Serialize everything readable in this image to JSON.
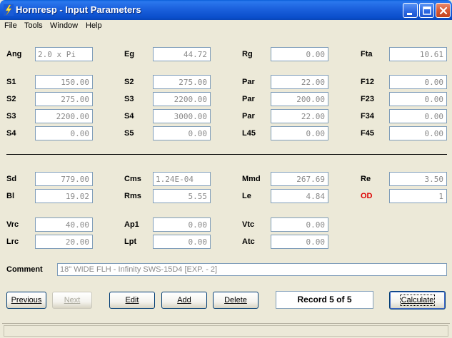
{
  "window": {
    "title": "Hornresp - Input Parameters"
  },
  "menu": {
    "items": [
      "File",
      "Tools",
      "Window",
      "Help"
    ]
  },
  "rows": [
    {
      "top": "row1",
      "cells": [
        {
          "label": "Ang",
          "value": "2.0 x Pi",
          "align": "left"
        },
        {
          "label": "Eg",
          "value": "44.72"
        },
        {
          "label": "Rg",
          "value": "0.00"
        },
        {
          "label": "Fta",
          "value": "10.61"
        }
      ]
    },
    {
      "cells": [
        {
          "label": "S1",
          "value": "150.00"
        },
        {
          "label": "S2",
          "value": "275.00"
        },
        {
          "label": "Par",
          "value": "22.00"
        },
        {
          "label": "F12",
          "value": "0.00"
        }
      ]
    },
    {
      "cells": [
        {
          "label": "S2",
          "value": "275.00"
        },
        {
          "label": "S3",
          "value": "2200.00"
        },
        {
          "label": "Par",
          "value": "200.00"
        },
        {
          "label": "F23",
          "value": "0.00"
        }
      ]
    },
    {
      "cells": [
        {
          "label": "S3",
          "value": "2200.00"
        },
        {
          "label": "S4",
          "value": "3000.00"
        },
        {
          "label": "Par",
          "value": "22.00"
        },
        {
          "label": "F34",
          "value": "0.00"
        }
      ]
    },
    {
      "cells": [
        {
          "label": "S4",
          "value": "0.00"
        },
        {
          "label": "S5",
          "value": "0.00"
        },
        {
          "label": "L45",
          "value": "0.00"
        },
        {
          "label": "F45",
          "value": "0.00"
        }
      ]
    },
    {
      "cells": [
        {
          "label": "Sd",
          "value": "779.00"
        },
        {
          "label": "Cms",
          "value": "1.24E-04",
          "align": "left"
        },
        {
          "label": "Mmd",
          "value": "267.69"
        },
        {
          "label": "Re",
          "value": "3.50"
        }
      ]
    },
    {
      "cells": [
        {
          "label": "Bl",
          "value": "19.02"
        },
        {
          "label": "Rms",
          "value": "5.55"
        },
        {
          "label": "Le",
          "value": "4.84"
        },
        {
          "label": "OD",
          "value": "1",
          "label_color": "red"
        }
      ]
    },
    {
      "cells": [
        {
          "label": "Vrc",
          "value": "40.00"
        },
        {
          "label": "Ap1",
          "value": "0.00"
        },
        {
          "label": "Vtc",
          "value": "0.00"
        }
      ]
    },
    {
      "cells": [
        {
          "label": "Lrc",
          "value": "20.00"
        },
        {
          "label": "Lpt",
          "value": "0.00"
        },
        {
          "label": "Atc",
          "value": "0.00"
        }
      ]
    }
  ],
  "comment": {
    "label": "Comment",
    "value": "18\" WIDE FLH - Infinity SWS-15D4  [EXP. - 2]"
  },
  "buttons": {
    "previous": "Previous",
    "next": "Next",
    "edit": "Edit",
    "add": "Add",
    "delete": "Delete",
    "calculate": "Calculate"
  },
  "record": "Record 5 of 5"
}
